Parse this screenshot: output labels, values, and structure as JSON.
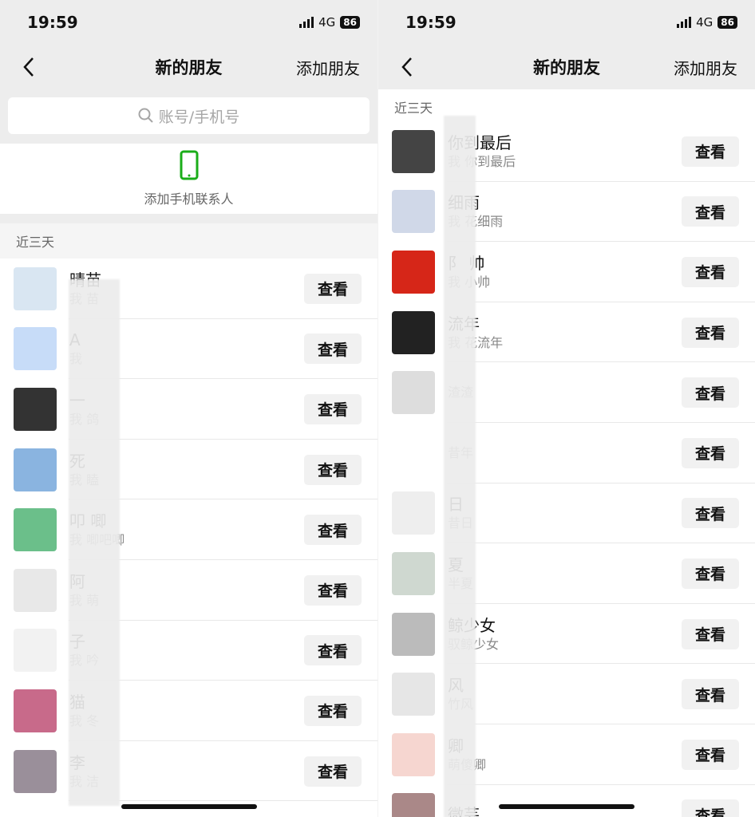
{
  "status": {
    "time": "19:59",
    "network": "4G",
    "battery": "86"
  },
  "nav": {
    "title": "新的朋友",
    "action": "添加朋友"
  },
  "search": {
    "placeholder": "账号/手机号"
  },
  "add_phone": {
    "label": "添加手机联系人"
  },
  "section": {
    "recent": "近三天"
  },
  "button_label": "查看",
  "colors": {
    "bg_gray": "#ededed",
    "phone_icon": "#1aad19"
  },
  "left_list": [
    {
      "name": "晴苗",
      "msg": "我  苗"
    },
    {
      "name": "A",
      "msg": "我"
    },
    {
      "name": "一",
      "msg": "我  鸽"
    },
    {
      "name": "死",
      "msg": "我  瞌"
    },
    {
      "name": "叩  唧",
      "msg": "我  唧吧唧"
    },
    {
      "name": "阿",
      "msg": "我  萌"
    },
    {
      "name": "子",
      "msg": "我  吟"
    },
    {
      "name": "猫",
      "msg": "我  冬"
    },
    {
      "name": "李",
      "msg": "我  洁"
    }
  ],
  "right_list": [
    {
      "name": "你到最后",
      "msg": "我  你到最后"
    },
    {
      "name": "  细雨",
      "msg": "我  花细雨"
    },
    {
      "name": "阝  帅",
      "msg": "我  小帅"
    },
    {
      "name": "  流年",
      "msg": "我  花流年"
    },
    {
      "name": "",
      "msg": "  渣渣"
    },
    {
      "name": "",
      "msg": "  昔年"
    },
    {
      "name": "  日",
      "msg": "  昔日"
    },
    {
      "name": "  夏",
      "msg": "  半夏"
    },
    {
      "name": "  鲸少女",
      "msg": "  驭鲸少女"
    },
    {
      "name": "  风",
      "msg": "  竹风"
    },
    {
      "name": "  卿",
      "msg": "  萌傻卿"
    },
    {
      "name": "  微芸",
      "msg": ""
    }
  ]
}
